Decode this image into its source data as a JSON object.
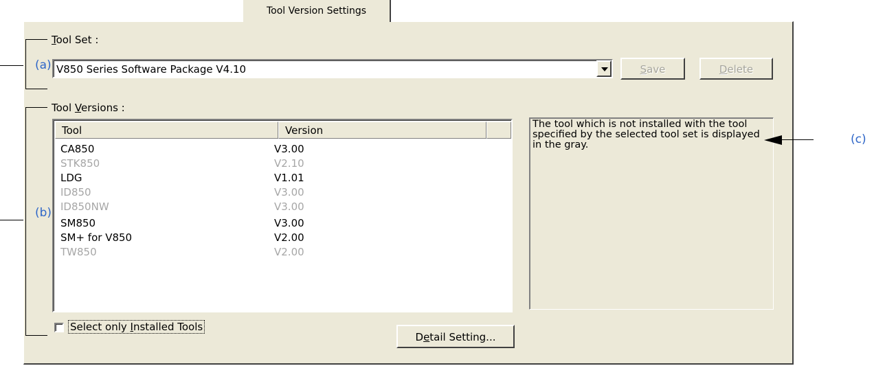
{
  "tab": {
    "label": "Tool Version Settings"
  },
  "tool_set": {
    "label_accel": "T",
    "label_rest": "ool Set :",
    "selected_value": "V850 Series Software Package V4.10",
    "save_accel": "S",
    "save_rest": "ave",
    "delete_accel": "D",
    "delete_rest": "elete"
  },
  "tool_versions": {
    "label_pre": "Tool ",
    "label_accel": "V",
    "label_rest": "ersions :",
    "columns": [
      "Tool",
      "Version"
    ],
    "rows": [
      {
        "tool": "CA850",
        "version": "V3.00",
        "installed": true
      },
      {
        "tool": "STK850",
        "version": "V2.10",
        "installed": false
      },
      {
        "tool": "LDG",
        "version": "V1.01",
        "installed": true
      },
      {
        "tool": "ID850",
        "version": "V3.00",
        "installed": false
      },
      {
        "tool": "ID850NW",
        "version": "V3.00",
        "installed": false
      },
      {
        "tool": "SM850",
        "version": "V3.00",
        "installed": true
      },
      {
        "tool": "SM+ for V850",
        "version": "V2.00",
        "installed": true
      },
      {
        "tool": "TW850",
        "version": "V2.00",
        "installed": false
      }
    ],
    "description": "The tool which is not installed with the tool specified by the selected tool set is displayed in the gray.",
    "checkbox_pre": "Select only ",
    "checkbox_accel": "I",
    "checkbox_rest": "nstalled Tools",
    "checkbox_checked": false,
    "detail_pre": "D",
    "detail_accel": "e",
    "detail_rest": "tail Setting..."
  },
  "callouts": {
    "a": "(a)",
    "b": "(b)",
    "c": "(c)"
  },
  "colors": {
    "callout": "#2e66c8",
    "dialog_bg": "#ece9d8",
    "disabled_text": "#a6a6a6"
  }
}
